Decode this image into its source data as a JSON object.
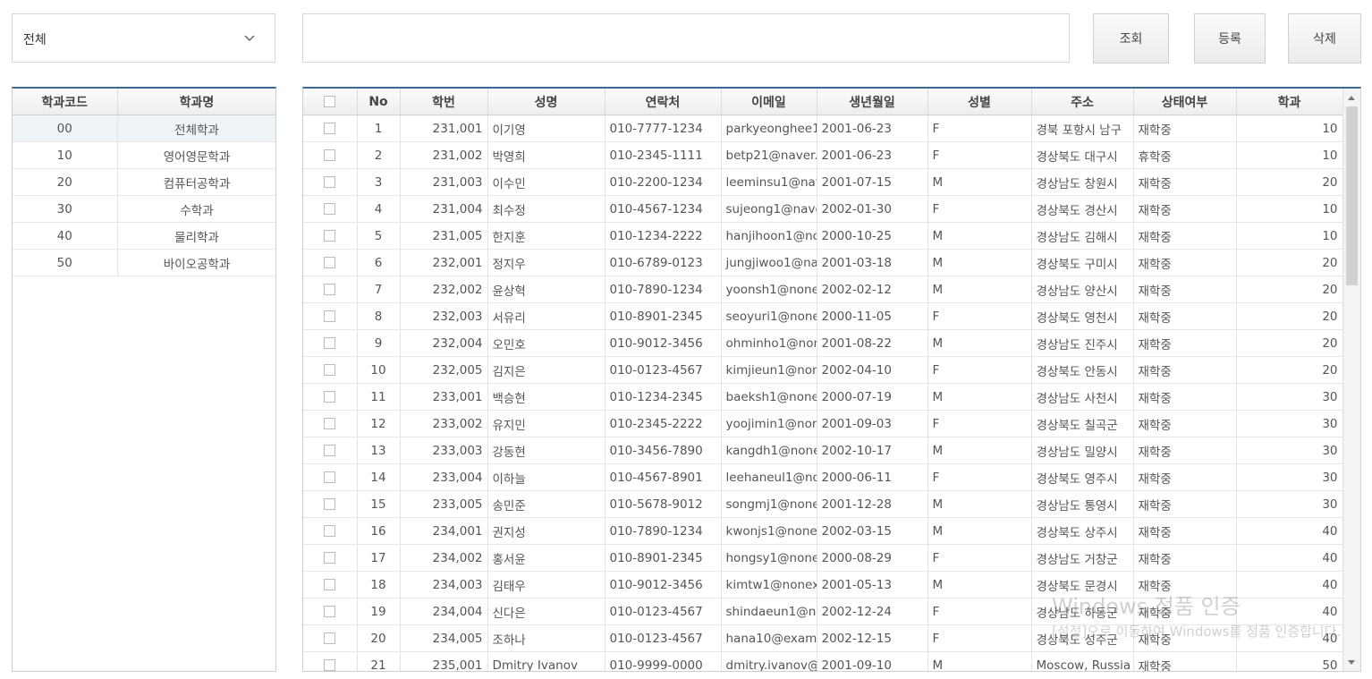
{
  "filter": {
    "selected": "전체"
  },
  "search": {
    "value": "",
    "placeholder": ""
  },
  "buttons": {
    "query": "조회",
    "register": "등록",
    "delete": "삭제"
  },
  "departments": {
    "columns": [
      "학과코드",
      "학과명"
    ],
    "rows": [
      {
        "code": "00",
        "name": "전체학과"
      },
      {
        "code": "10",
        "name": "영어영문학과"
      },
      {
        "code": "20",
        "name": "컴퓨터공학과"
      },
      {
        "code": "30",
        "name": "수학과"
      },
      {
        "code": "40",
        "name": "물리학과"
      },
      {
        "code": "50",
        "name": "바이오공학과"
      }
    ]
  },
  "students": {
    "columns": [
      "No",
      "학번",
      "성명",
      "연락처",
      "이메일",
      "생년월일",
      "성별",
      "주소",
      "상태여부",
      "학과"
    ],
    "rows": [
      {
        "no": "1",
        "id": "231,001",
        "name": "이기영",
        "phone": "010-7777-1234",
        "email": "parkyeonghee1",
        "birth": "2001-06-23",
        "gender": "F",
        "addr": "경북 포항시 남구",
        "status": "재학중",
        "dept": "10"
      },
      {
        "no": "2",
        "id": "231,002",
        "name": "박영희",
        "phone": "010-2345-1111",
        "email": "betp21@naver.c",
        "birth": "2001-06-23",
        "gender": "F",
        "addr": "경상북도 대구시",
        "status": "휴학중",
        "dept": "10"
      },
      {
        "no": "3",
        "id": "231,003",
        "name": "이수민",
        "phone": "010-2200-1234",
        "email": "leeminsu1@nav",
        "birth": "2001-07-15",
        "gender": "M",
        "addr": "경상남도 창원시",
        "status": "재학중",
        "dept": "20"
      },
      {
        "no": "4",
        "id": "231,004",
        "name": "최수정",
        "phone": "010-4567-1234",
        "email": "sujeong1@nave",
        "birth": "2002-01-30",
        "gender": "F",
        "addr": "경상북도 경산시",
        "status": "재학중",
        "dept": "10"
      },
      {
        "no": "5",
        "id": "231,005",
        "name": "한지훈",
        "phone": "010-1234-2222",
        "email": "hanjihoon1@no",
        "birth": "2000-10-25",
        "gender": "M",
        "addr": "경상남도 김해시",
        "status": "재학중",
        "dept": "10"
      },
      {
        "no": "6",
        "id": "232,001",
        "name": "정지우",
        "phone": "010-6789-0123",
        "email": "jungjiwoo1@nav",
        "birth": "2001-03-18",
        "gender": "M",
        "addr": "경상북도 구미시",
        "status": "재학중",
        "dept": "20"
      },
      {
        "no": "7",
        "id": "232,002",
        "name": "윤상혁",
        "phone": "010-7890-1234",
        "email": "yoonsh1@none",
        "birth": "2002-02-12",
        "gender": "M",
        "addr": "경상남도 양산시",
        "status": "재학중",
        "dept": "20"
      },
      {
        "no": "8",
        "id": "232,003",
        "name": "서유리",
        "phone": "010-8901-2345",
        "email": "seoyuri1@none",
        "birth": "2000-11-05",
        "gender": "F",
        "addr": "경상북도 영천시",
        "status": "재학중",
        "dept": "20"
      },
      {
        "no": "9",
        "id": "232,004",
        "name": "오민호",
        "phone": "010-9012-3456",
        "email": "ohminho1@non",
        "birth": "2001-08-22",
        "gender": "M",
        "addr": "경상남도 진주시",
        "status": "재학중",
        "dept": "20"
      },
      {
        "no": "10",
        "id": "232,005",
        "name": "김지은",
        "phone": "010-0123-4567",
        "email": "kimjieun1@none",
        "birth": "2002-04-10",
        "gender": "F",
        "addr": "경상북도 안동시",
        "status": "재학중",
        "dept": "20"
      },
      {
        "no": "11",
        "id": "233,001",
        "name": "백승현",
        "phone": "010-1234-2345",
        "email": "baeksh1@none",
        "birth": "2000-07-19",
        "gender": "M",
        "addr": "경상남도 사천시",
        "status": "재학중",
        "dept": "30"
      },
      {
        "no": "12",
        "id": "233,002",
        "name": "유지민",
        "phone": "010-2345-2222",
        "email": "yoojimin1@non",
        "birth": "2001-09-03",
        "gender": "F",
        "addr": "경상북도 칠곡군",
        "status": "재학중",
        "dept": "30"
      },
      {
        "no": "13",
        "id": "233,003",
        "name": "강동현",
        "phone": "010-3456-7890",
        "email": "kangdh1@none",
        "birth": "2002-10-17",
        "gender": "M",
        "addr": "경상남도 밀양시",
        "status": "재학중",
        "dept": "30"
      },
      {
        "no": "14",
        "id": "233,004",
        "name": "이하늘",
        "phone": "010-4567-8901",
        "email": "leehaneul1@no",
        "birth": "2000-06-11",
        "gender": "F",
        "addr": "경상북도 영주시",
        "status": "재학중",
        "dept": "30"
      },
      {
        "no": "15",
        "id": "233,005",
        "name": "송민준",
        "phone": "010-5678-9012",
        "email": "songmj1@none",
        "birth": "2001-12-28",
        "gender": "M",
        "addr": "경상남도 통영시",
        "status": "재학중",
        "dept": "30"
      },
      {
        "no": "16",
        "id": "234,001",
        "name": "권지성",
        "phone": "010-7890-1234",
        "email": "kwonjs1@none",
        "birth": "2002-03-15",
        "gender": "M",
        "addr": "경상북도 상주시",
        "status": "재학중",
        "dept": "40"
      },
      {
        "no": "17",
        "id": "234,002",
        "name": "홍서윤",
        "phone": "010-8901-2345",
        "email": "hongsy1@none",
        "birth": "2000-08-29",
        "gender": "F",
        "addr": "경상남도 거창군",
        "status": "재학중",
        "dept": "40"
      },
      {
        "no": "18",
        "id": "234,003",
        "name": "김태우",
        "phone": "010-9012-3456",
        "email": "kimtw1@nonexi",
        "birth": "2001-05-13",
        "gender": "M",
        "addr": "경상북도 문경시",
        "status": "재학중",
        "dept": "40"
      },
      {
        "no": "19",
        "id": "234,004",
        "name": "신다은",
        "phone": "010-0123-4567",
        "email": "shindaeun1@no",
        "birth": "2002-12-24",
        "gender": "F",
        "addr": "경상남도 하동군",
        "status": "재학중",
        "dept": "40"
      },
      {
        "no": "20",
        "id": "234,005",
        "name": "조하나",
        "phone": "010-0123-4567",
        "email": "hana10@examp",
        "birth": "2002-12-15",
        "gender": "F",
        "addr": "경상북도 성주군",
        "status": "재학중",
        "dept": "40"
      },
      {
        "no": "21",
        "id": "235,001",
        "name": "Dmitry Ivanov",
        "phone": "010-9999-0000",
        "email": "dmitry.ivanov@",
        "birth": "2001-09-10",
        "gender": "M",
        "addr": "Moscow, Russia",
        "status": "재학중",
        "dept": "50"
      }
    ]
  },
  "watermark": {
    "title": "Windows 정품 인증",
    "subtitle": "[설정]으로 이동하여 Windows를 정품 인증합니다."
  }
}
